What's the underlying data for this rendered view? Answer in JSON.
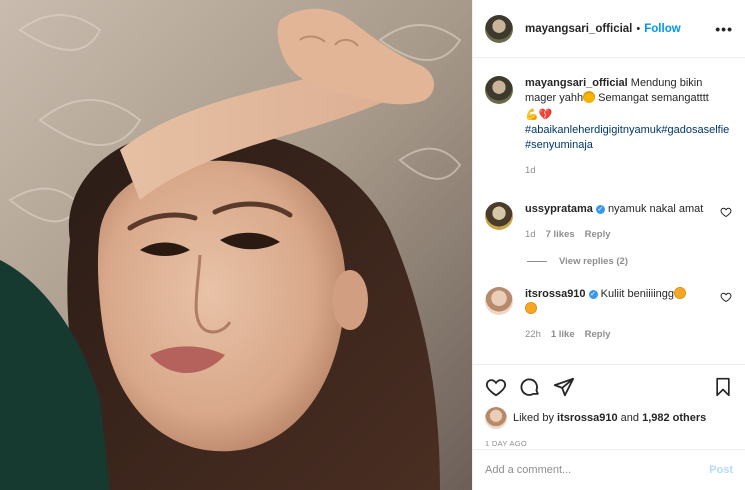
{
  "header": {
    "username": "mayangsari_official",
    "separator": "•",
    "follow_label": "Follow",
    "more_label": "•••"
  },
  "caption": {
    "username": "mayangsari_official",
    "text_1": "Mendung bikin mager yahh",
    "text_2": " Semangat semangatttt",
    "hashtags": "#abaikanleherdigigitnyamuk#gadosaselfie#senyuminaja",
    "time": "1d"
  },
  "comments": [
    {
      "username": "ussypratama",
      "text": "nyamuk nakal amat",
      "time": "1d",
      "likes": "7 likes",
      "reply_label": "Reply",
      "view_replies": "View replies (2)"
    },
    {
      "username": "itsrossa910",
      "text": "Kuliit beniiiingg",
      "time": "22h",
      "likes": "1 like",
      "reply_label": "Reply"
    }
  ],
  "likes": {
    "prefix": "Liked by ",
    "user": "itsrossa910",
    "middle": " and ",
    "count": "1,982 others"
  },
  "timestamp": "1 DAY AGO",
  "comment_box": {
    "placeholder": "Add a comment...",
    "post_label": "Post"
  },
  "colors": {
    "accent": "#0095f6",
    "hashtag": "#00376b",
    "muted": "#8e8e8e",
    "verified": "#3897f0"
  },
  "icons": [
    "heart-icon",
    "comment-icon",
    "share-icon",
    "bookmark-icon",
    "verified-badge-icon",
    "more-options-icon"
  ]
}
